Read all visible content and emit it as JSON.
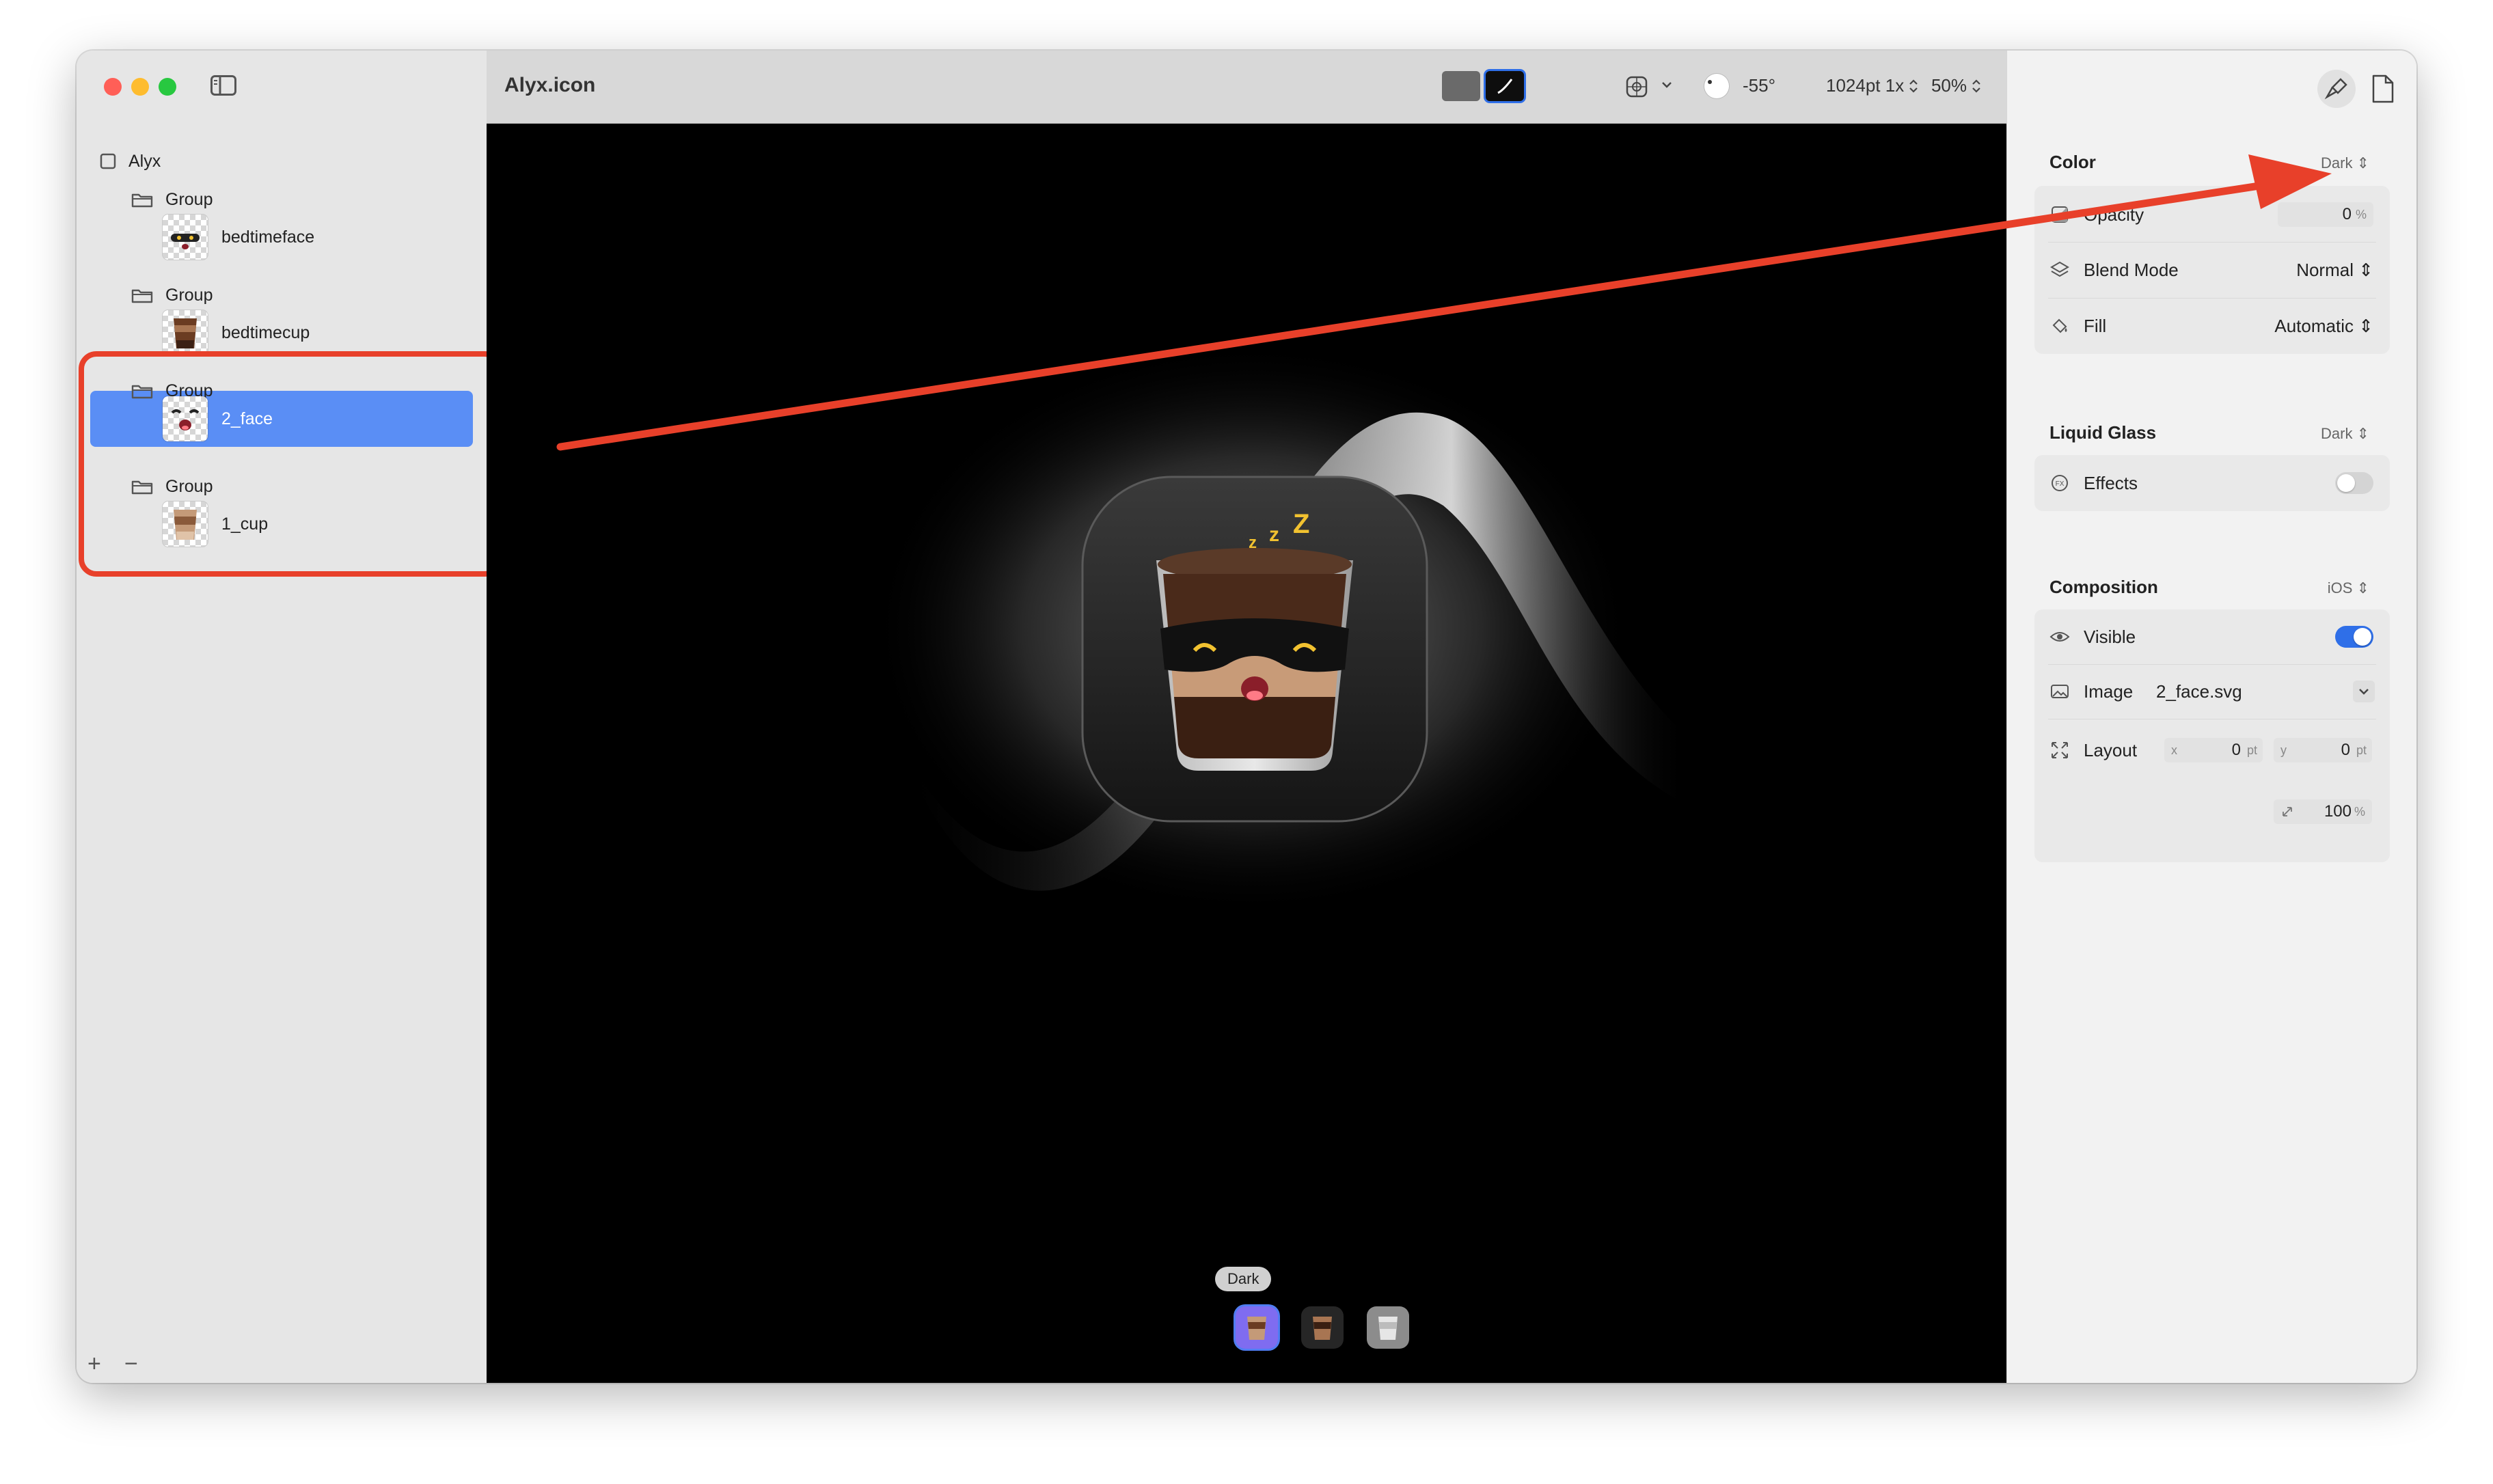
{
  "sidebar": {
    "items": [
      {
        "label": "Alyx"
      },
      {
        "label": "Group"
      },
      {
        "label": "bedtimeface"
      },
      {
        "label": "Group"
      },
      {
        "label": "bedtimecup"
      },
      {
        "label": "Group"
      },
      {
        "label": "2_face"
      },
      {
        "label": "Group"
      },
      {
        "label": "1_cup"
      }
    ],
    "add_label": "+",
    "remove_label": "−"
  },
  "toolbar": {
    "title": "Alyx.icon",
    "angle": "-55°",
    "size": "1024pt 1x",
    "zoom": "50%"
  },
  "canvas": {
    "appearance_badge": "Dark",
    "variants": [
      "default",
      "dark",
      "clear"
    ]
  },
  "inspector": {
    "color": {
      "title": "Color",
      "mode": "Dark",
      "opacity_label": "Opacity",
      "opacity_value": "0",
      "opacity_unit": "%",
      "blend_label": "Blend Mode",
      "blend_value": "Normal",
      "fill_label": "Fill",
      "fill_value": "Automatic"
    },
    "liquid_glass": {
      "title": "Liquid Glass",
      "mode": "Dark",
      "effects_label": "Effects",
      "effects_on": false
    },
    "composition": {
      "title": "Composition",
      "platform": "iOS",
      "visible_label": "Visible",
      "visible_on": true,
      "image_label": "Image",
      "image_value": "2_face.svg",
      "layout_label": "Layout",
      "x_label": "x",
      "x_value": "0",
      "y_label": "y",
      "y_value": "0",
      "unit": "pt",
      "scale_value": "100",
      "scale_unit": "%"
    }
  },
  "colors": {
    "selection": "#5a8ef5",
    "annotation": "#e8402a",
    "toggle_on": "#2f6fe8"
  }
}
